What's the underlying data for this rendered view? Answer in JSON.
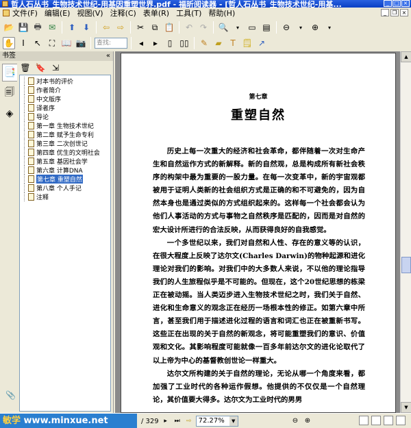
{
  "window": {
    "title": "哲人石丛书_生物技术世纪-用基因重塑世界.pdf - 福昕阅读器 - [哲人石丛书_生物技术世纪-用基..."
  },
  "menu": {
    "items": [
      "文件(F)",
      "编辑(E)",
      "视图(V)",
      "注释(C)",
      "表单(R)",
      "工具(T)",
      "帮助(H)"
    ]
  },
  "toolbar": {
    "find_placeholder": "查找:"
  },
  "bookmarks": {
    "header": "书签",
    "items": [
      {
        "label": "对本书的评价"
      },
      {
        "label": "作者简介"
      },
      {
        "label": "中文版序"
      },
      {
        "label": "译者序"
      },
      {
        "label": "导论"
      },
      {
        "label": "第一章 生物技术世纪"
      },
      {
        "label": "第二章 赋予生命专利"
      },
      {
        "label": "第三章 二次创世记"
      },
      {
        "label": "第四章 优生的文明社会"
      },
      {
        "label": "第五章 基因社会学"
      },
      {
        "label": "第六章 计算DNA"
      },
      {
        "label": "第七章 重塑自然",
        "selected": true
      },
      {
        "label": "第八章 个人手记"
      },
      {
        "label": "注释"
      }
    ]
  },
  "document": {
    "chapter_number": "第七章",
    "chapter_title": "重塑自然",
    "paragraphs": [
      "历史上每一次重大的经济和社会革命，都伴随着一次对生命产生和自然运作方式的新解释。新的自然观，总是构成所有新社会秩序的构架中最为重要的一股力量。在每一次变革中，新的宇宙观都被用于证明人类新的社会组织方式是正确的和不可避免的，因为自然本身也是通过类似的方式组织起来的。这样每一个社会都会认为他们人事活动的方式与事物之自然秩序是匹配的，因而是对自然的宏大设计所进行的合法反映，从而获得良好的自我感觉。",
      "一个多世纪以来，我们对自然和人性、存在的意义等的认识，在很大程度上反映了达尔文(Charles Darwin)的物种起源和进化理论对我们的影响。对我们中的大多数人来说，不以他的理论指导我们的人生旅程似乎是不可能的。但现在，这个20世纪思想的栋梁正在被动摇。当人类迈步进入生物技术世纪之时，我们关于自然、进化和生命意义的观念正在经历一场根本性的修正。如第六章中所言，甚至我们用于描述进化过程的语言和词汇也正在被重新书写。这些正在出现的关于自然的新观念，将可能重塑我们的意识、价值观和文化。其影响程度可能就像一百多年前达尔文的进化论取代了以上帝为中心的基督教创世论一样重大。",
      "达尔文所构建的关于自然的理论，无论从哪一个角度来看，都加强了工业时代的各种运作假想。他提供的不仅仅是一个自然理论，其价值要大得多。达尔文为工业时代的男男"
    ]
  },
  "status": {
    "watermark_logo": "敏学",
    "watermark_url": "www.minxue.net",
    "page_total": "/ 329",
    "zoom": "72.27%"
  }
}
